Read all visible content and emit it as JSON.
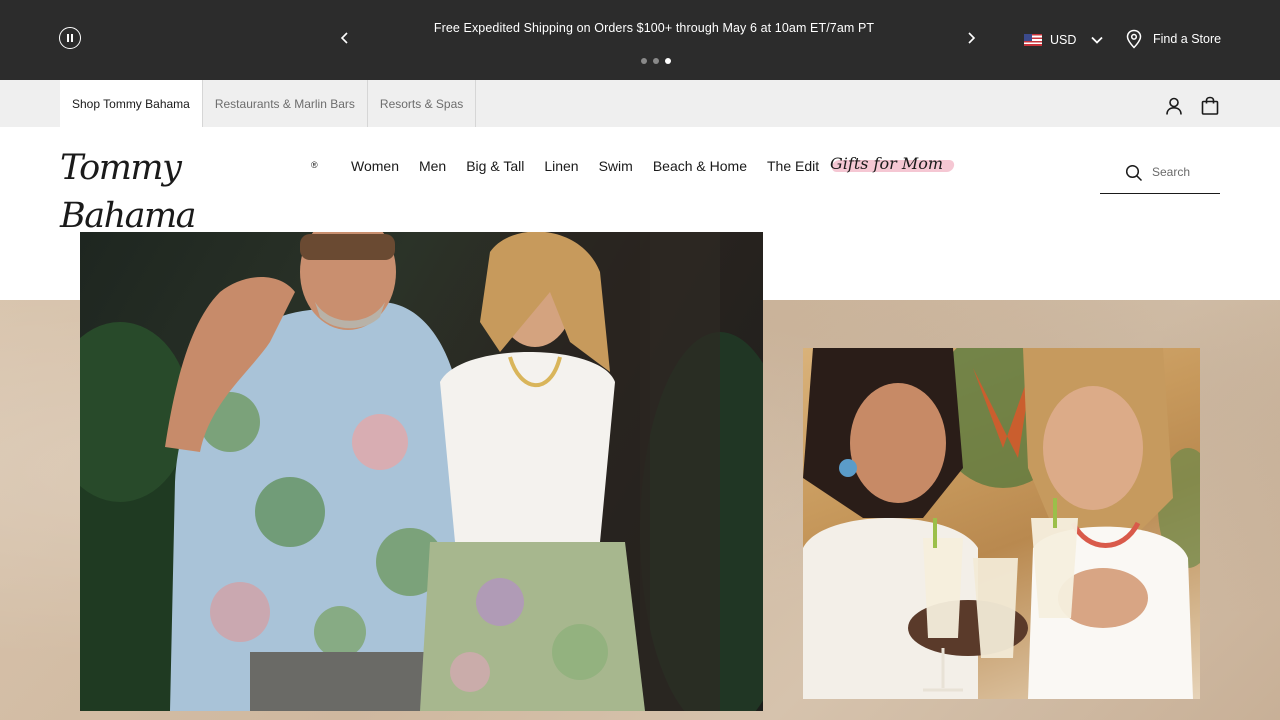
{
  "promo": {
    "message": "Free Expedited Shipping on Orders $100+ through May 6 at 10am ET/7am PT",
    "slides_total": 3,
    "active_slide": 3,
    "pause_icon": "pause-circle-icon",
    "prev_icon": "chevron-left-icon",
    "next_icon": "chevron-right-icon"
  },
  "currency": {
    "code": "USD",
    "flag_icon": "us-flag-icon"
  },
  "store_link": {
    "label": "Find a Store",
    "icon": "location-pin-icon"
  },
  "tabs": [
    {
      "label": "Shop Tommy Bahama",
      "active": true
    },
    {
      "label": "Restaurants & Marlin Bars",
      "active": false
    },
    {
      "label": "Resorts & Spas",
      "active": false
    }
  ],
  "utility_icons": {
    "account": "user-icon",
    "bag": "shopping-bag-icon"
  },
  "logo": {
    "text": "Tommy Bahama",
    "reg": "®"
  },
  "nav": [
    "Women",
    "Men",
    "Big & Tall",
    "Linen",
    "Swim",
    "Beach & Home",
    "The Edit"
  ],
  "gifts_link": "Gifts for Mom",
  "search": {
    "placeholder": "Search",
    "icon": "search-icon"
  },
  "colors": {
    "promo_bg": "#2c2c2c",
    "tab_bar_bg": "#efefef",
    "hero_bg": "#d3bea6",
    "gifts_highlight": "#f3b9c8"
  },
  "hero": {
    "main_image": "couple-in-floral-shirts-photo",
    "side_image": "women-toasting-cocktails-photo"
  }
}
